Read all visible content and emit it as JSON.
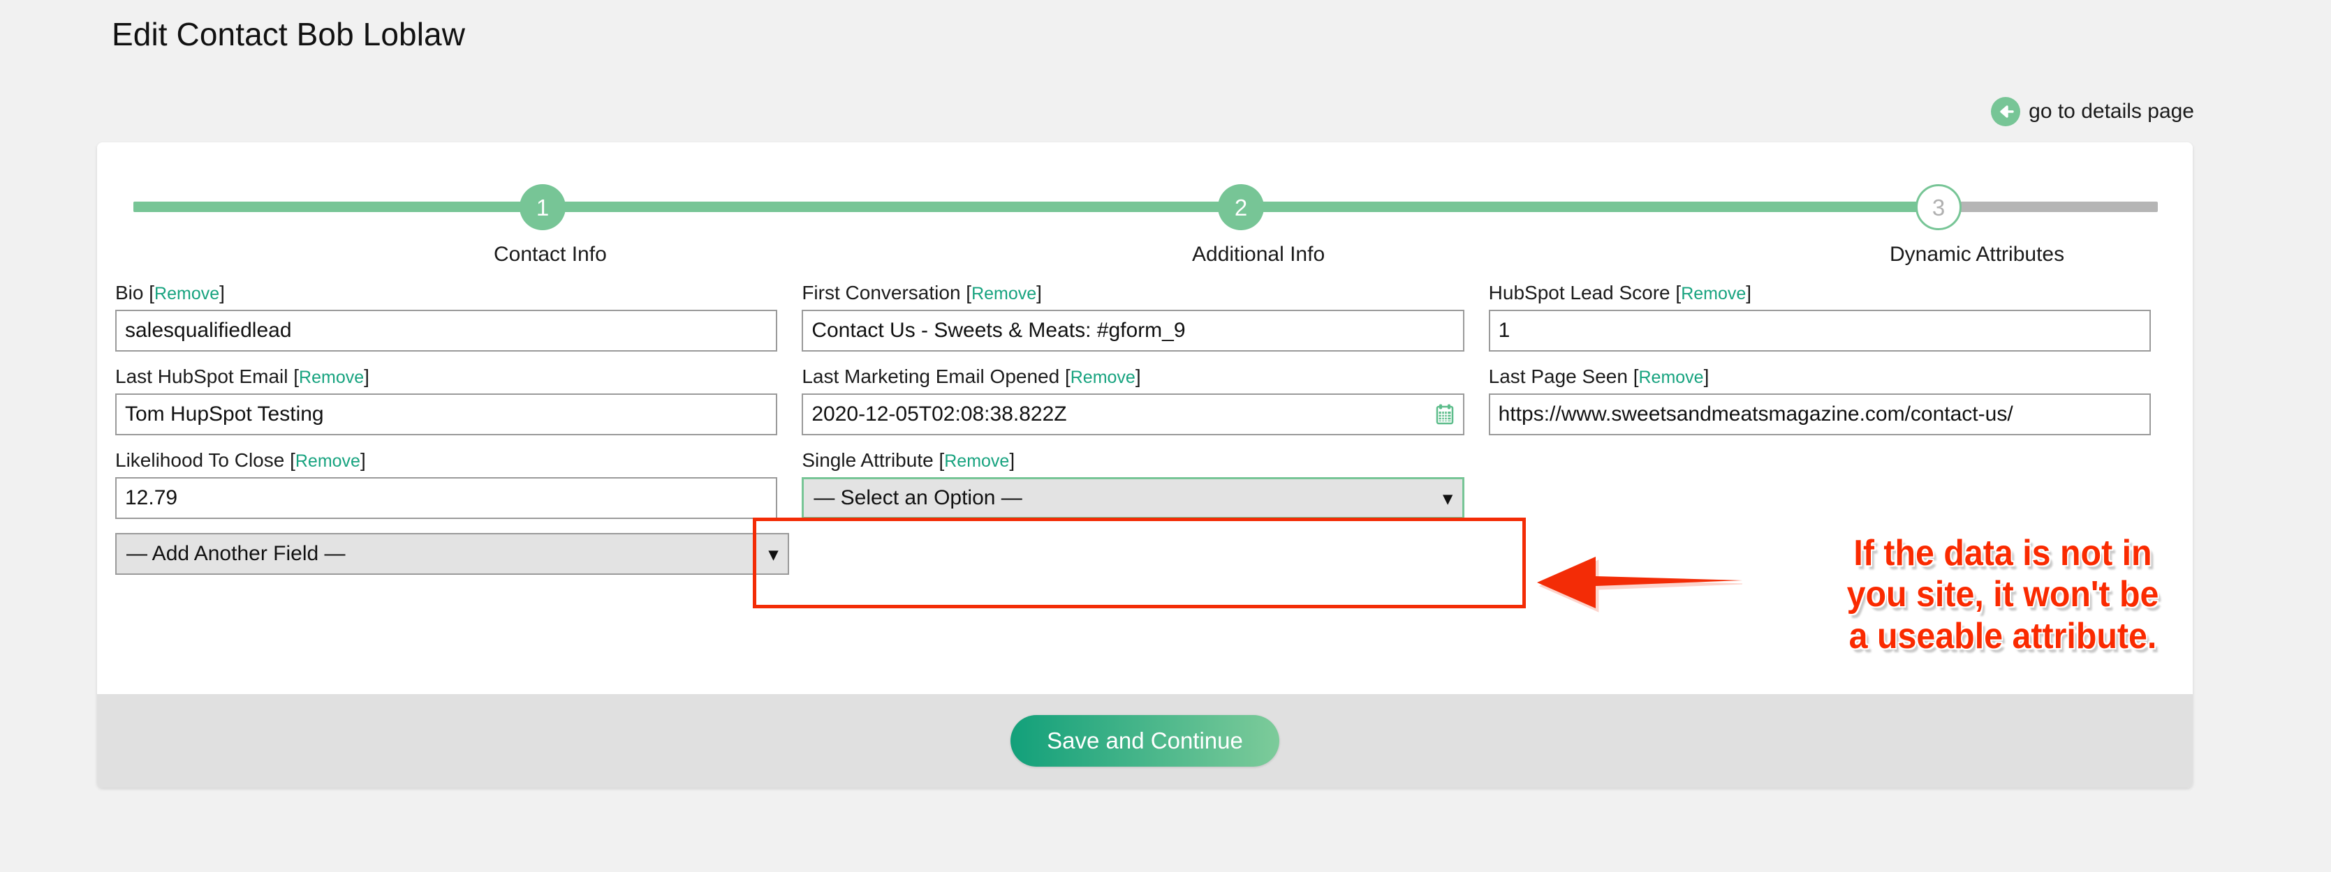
{
  "page": {
    "title": "Edit Contact Bob Loblaw"
  },
  "details_link": {
    "label": "go to details page",
    "icon": "arrow-left-circle-icon",
    "color": "#77c596"
  },
  "stepper": {
    "steps": [
      {
        "number": "1",
        "label": "Contact Info",
        "state": "done"
      },
      {
        "number": "2",
        "label": "Additional Info",
        "state": "done"
      },
      {
        "number": "3",
        "label": "Dynamic Attributes",
        "state": "current"
      }
    ],
    "active_color": "#77c596",
    "inactive_color": "#b5b5b5"
  },
  "form": {
    "remove_label": "Remove",
    "rows": [
      [
        {
          "label": "Bio",
          "value": "salesqualifiedlead",
          "type": "text"
        },
        {
          "label": "First Conversation",
          "value": "Contact Us - Sweets & Meats: #gform_9",
          "type": "text"
        },
        {
          "label": "HubSpot Lead Score",
          "value": "1",
          "type": "text"
        }
      ],
      [
        {
          "label": "Last HubSpot Email",
          "value": "Tom HupSpot Testing",
          "type": "text"
        },
        {
          "label": "Last Marketing Email Opened",
          "value": "2020-12-05T02:08:38.822Z",
          "type": "date",
          "icon": "calendar-icon"
        },
        {
          "label": "Last Page Seen",
          "value": "https://www.sweetsandmeatsmagazine.com/contact-us/",
          "type": "text"
        }
      ],
      [
        {
          "label": "Likelihood To Close",
          "value": "12.79",
          "type": "text"
        },
        {
          "label": "Single Attribute",
          "value": "— Select an Option —",
          "type": "select",
          "highlighted": true
        },
        {
          "label": "",
          "value": "",
          "type": "empty"
        }
      ]
    ],
    "add_another_field": {
      "value": "— Add Another Field —",
      "icon": "chevron-down-icon"
    }
  },
  "footer": {
    "save_label": "Save and Continue"
  },
  "annotation": {
    "lines": [
      "If the data is not in",
      "you site, it won't be",
      "a useable attribute."
    ],
    "color": "#fa2a00",
    "arrow": "arrow-left-annotation"
  }
}
